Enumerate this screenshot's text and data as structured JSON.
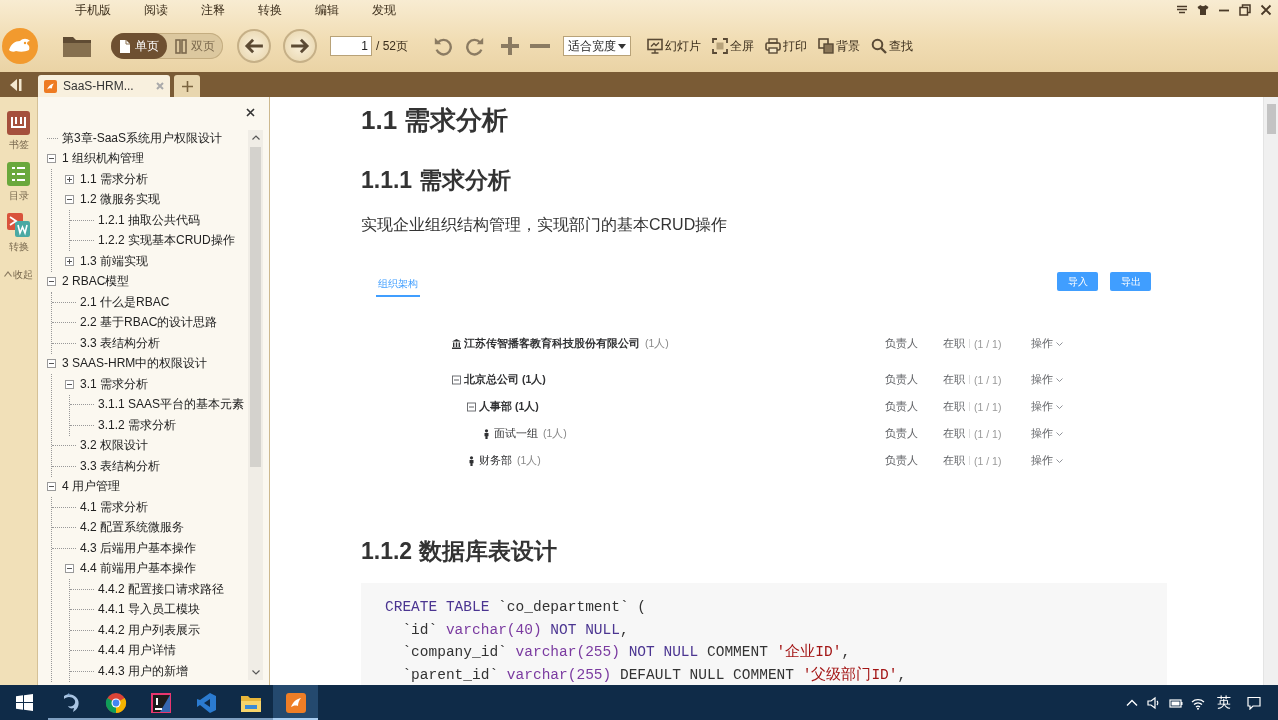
{
  "menu": [
    "手机版",
    "阅读",
    "注释",
    "转换",
    "编辑",
    "发现"
  ],
  "toolbar": {
    "view_modes": [
      {
        "label": "单页",
        "kind": "single",
        "selected": true
      },
      {
        "label": "双页",
        "kind": "double",
        "selected": false
      }
    ],
    "page_input": {
      "value": "1"
    },
    "page_total": "/ 52页",
    "zoom_select": {
      "value": "适合宽度"
    },
    "actions": [
      {
        "label": "幻灯片",
        "kind": "slideshow"
      },
      {
        "label": "全屏",
        "kind": "fullscreen"
      },
      {
        "label": "打印",
        "kind": "print"
      },
      {
        "label": "背景",
        "kind": "background"
      },
      {
        "label": "查找",
        "kind": "find"
      }
    ]
  },
  "tabs": [
    {
      "label": "SaaS-HRM...",
      "selected": true
    }
  ],
  "side_strip": [
    {
      "label": "书签",
      "kind": "bookmark"
    },
    {
      "label": "目录",
      "kind": "contents"
    },
    {
      "label": "转换",
      "kind": "convert"
    },
    {
      "label": "收起",
      "kind": "collapse"
    }
  ],
  "toc": {
    "items": [
      {
        "label": "第3章-SaaS系统用户权限设计"
      },
      {
        "label": "1 组织机构管理",
        "expanded": true,
        "children": [
          {
            "label": "1.1 需求分析",
            "expanded": false
          },
          {
            "label": "1.2 微服务实现",
            "expanded": true,
            "children": [
              {
                "label": "1.2.1 抽取公共代码"
              },
              {
                "label": "1.2.2 实现基本CRUD操作"
              }
            ]
          },
          {
            "label": "1.3 前端实现",
            "expanded": false
          }
        ]
      },
      {
        "label": "2 RBAC模型",
        "expanded": true,
        "children": [
          {
            "label": "2.1 什么是RBAC"
          },
          {
            "label": "2.2 基于RBAC的设计思路"
          },
          {
            "label": "3.3 表结构分析"
          }
        ]
      },
      {
        "label": "3 SAAS-HRM中的权限设计",
        "expanded": true,
        "children": [
          {
            "label": "3.1 需求分析",
            "expanded": true,
            "children": [
              {
                "label": "3.1.1 SAAS平台的基本元素"
              },
              {
                "label": "3.1.2 需求分析"
              }
            ]
          },
          {
            "label": "3.2 权限设计"
          },
          {
            "label": "3.3 表结构分析"
          }
        ]
      },
      {
        "label": "4 用户管理",
        "expanded": true,
        "children": [
          {
            "label": "4.1 需求分析"
          },
          {
            "label": "4.2 配置系统微服务"
          },
          {
            "label": "4.3 后端用户基本操作"
          },
          {
            "label": "4.4 前端用户基本操作",
            "expanded": true,
            "children": [
              {
                "label": "4.4.2 配置接口请求路径"
              },
              {
                "label": "4.4.1 导入员工模块"
              },
              {
                "label": "4.4.2 用户列表展示"
              },
              {
                "label": "4.4.4 用户详情"
              },
              {
                "label": "4.4.3 用户的新增"
              }
            ]
          }
        ]
      }
    ]
  },
  "document": {
    "blocks": [
      {
        "kind": "h1",
        "text": "1.1 需求分析"
      },
      {
        "kind": "h2",
        "text": "1.1.1 需求分析"
      },
      {
        "kind": "paragraph",
        "text": "实现企业组织结构管理，实现部门的基本CRUD操作"
      },
      {
        "kind": "embedded_screenshot",
        "tab": {
          "label": "组织架构",
          "selected": true
        },
        "buttons": [
          "导入",
          "导出"
        ],
        "org": {
          "kind": "company",
          "name": "江苏传智播客教育科技股份有限公司",
          "count": "(1人)",
          "manager": "负责人",
          "status": "在职",
          "ratio": "(1 / 1)",
          "action": "操作",
          "children": [
            {
              "name": "北京总公司",
              "count": "(1人)",
              "manager": "负责人",
              "status": "在职",
              "ratio": "(1 / 1)",
              "action": "操作",
              "expanded": true,
              "children": [
                {
                  "name": "人事部",
                  "count": "(1人)",
                  "manager": "负责人",
                  "status": "在职",
                  "ratio": "(1 / 1)",
                  "action": "操作",
                  "expanded": true,
                  "children": [
                    {
                      "name": "面试一组",
                      "count": "(1人)",
                      "manager": "负责人",
                      "status": "在职",
                      "ratio": "(1 / 1)",
                      "action": "操作"
                    }
                  ]
                },
                {
                  "name": "财务部",
                  "count": "(1人)",
                  "manager": "负责人",
                  "status": "在职",
                  "ratio": "(1 / 1)",
                  "action": "操作"
                }
              ]
            }
          ]
        }
      },
      {
        "kind": "h2",
        "text": "1.1.2 数据库表设计"
      },
      {
        "kind": "code",
        "lines": [
          [
            {
              "kind": "keyword",
              "text": "CREATE TABLE"
            },
            {
              "kind": "plain",
              "text": " `co_department` ("
            }
          ],
          [
            {
              "kind": "plain",
              "text": "  `id` "
            },
            {
              "kind": "type",
              "text": "varchar(40) "
            },
            {
              "kind": "keyword",
              "text": "NOT NULL"
            },
            {
              "kind": "plain",
              "text": ","
            }
          ],
          [
            {
              "kind": "plain",
              "text": "  `company_id` "
            },
            {
              "kind": "type",
              "text": "varchar(255) "
            },
            {
              "kind": "keyword",
              "text": "NOT NULL"
            },
            {
              "kind": "plain",
              "text": " COMMENT "
            },
            {
              "kind": "string",
              "text": "'企业ID'"
            },
            {
              "kind": "plain",
              "text": ","
            }
          ],
          [
            {
              "kind": "plain",
              "text": "  `parent_id` "
            },
            {
              "kind": "type",
              "text": "varchar(255)"
            },
            {
              "kind": "plain",
              "text": " DEFAULT NULL COMMENT "
            },
            {
              "kind": "string",
              "text": "'父级部门ID'"
            },
            {
              "kind": "plain",
              "text": ","
            }
          ]
        ]
      }
    ]
  },
  "taskbar": {
    "apps": [
      {
        "kind": "dolphin",
        "running": true,
        "selected": false
      },
      {
        "kind": "browser",
        "running": true,
        "selected": false
      },
      {
        "kind": "ide",
        "running": true,
        "selected": false
      },
      {
        "kind": "editor",
        "running": true,
        "selected": false
      },
      {
        "kind": "files",
        "running": true,
        "selected": false
      },
      {
        "kind": "reader",
        "running": true,
        "selected": true
      }
    ],
    "language": "英"
  }
}
